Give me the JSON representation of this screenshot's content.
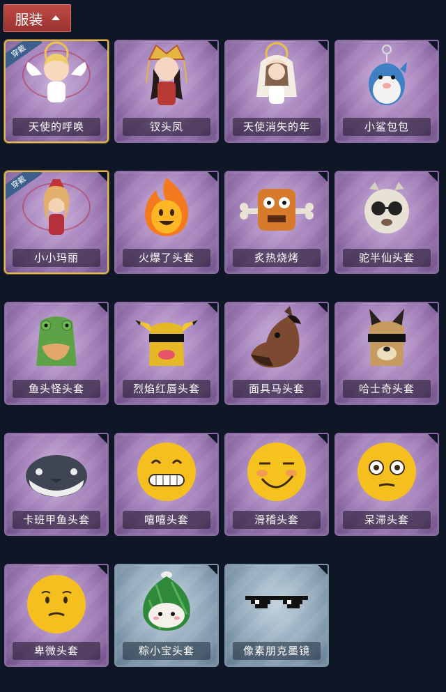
{
  "header": {
    "title": "服装"
  },
  "items": [
    {
      "name": "天使的呼唤",
      "badge": "穿戴",
      "worn": true,
      "frame": "purple",
      "icon": "angel-doll-icon"
    },
    {
      "name": "钗头凤",
      "frame": "purple",
      "icon": "crowned-doll-icon"
    },
    {
      "name": "天使消失的年",
      "frame": "purple",
      "icon": "veiled-doll-icon"
    },
    {
      "name": "小鲨包包",
      "frame": "purple",
      "icon": "shark-keychain-icon"
    },
    {
      "name": "小小玛丽",
      "badge": "穿戴",
      "worn": true,
      "frame": "purple",
      "icon": "mary-doll-icon"
    },
    {
      "name": "火爆了头套",
      "frame": "purple",
      "icon": "fire-head-icon"
    },
    {
      "name": "炙热烧烤",
      "frame": "purple",
      "icon": "bbq-meat-icon"
    },
    {
      "name": "驼半仙头套",
      "frame": "purple",
      "icon": "alpaca-head-icon"
    },
    {
      "name": "鱼头怪头套",
      "frame": "purple",
      "icon": "fish-head-icon"
    },
    {
      "name": "烈焰红唇头套",
      "frame": "purple",
      "icon": "yellow-mask-icon"
    },
    {
      "name": "面具马头套",
      "frame": "purple",
      "icon": "horse-head-icon"
    },
    {
      "name": "哈士奇头套",
      "frame": "purple",
      "icon": "husky-head-icon"
    },
    {
      "name": "卡班甲鱼头套",
      "frame": "purple",
      "icon": "whale-head-icon"
    },
    {
      "name": "嘻嘻头套",
      "frame": "purple",
      "icon": "grin-emoji-icon"
    },
    {
      "name": "滑稽头套",
      "frame": "purple",
      "icon": "smirk-emoji-icon"
    },
    {
      "name": "呆滞头套",
      "frame": "purple",
      "icon": "stare-emoji-icon"
    },
    {
      "name": "卑微头套",
      "frame": "purple",
      "icon": "humble-emoji-icon"
    },
    {
      "name": "粽小宝头套",
      "frame": "blue",
      "icon": "zongzi-head-icon"
    },
    {
      "name": "像素朋克墨镜",
      "frame": "blue",
      "icon": "pixel-sunglasses-icon"
    }
  ]
}
